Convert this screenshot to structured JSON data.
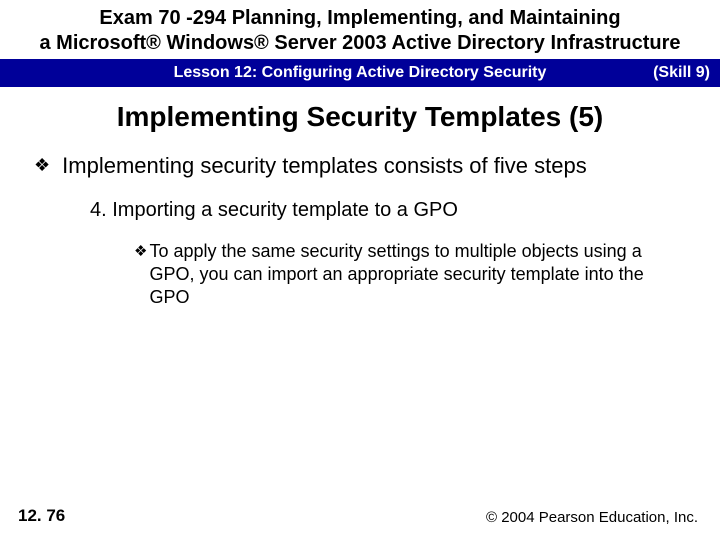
{
  "header": {
    "line1": "Exam 70 -294 Planning, Implementing, and Maintaining",
    "line2": "a Microsoft® Windows® Server 2003 Active Directory Infrastructure"
  },
  "bluebar": {
    "lesson": "Lesson 12: Configuring Active Directory Security",
    "skill": "(Skill 9)"
  },
  "title": "Implementing Security Templates (5)",
  "content": {
    "level1_bullet": "❖",
    "level1_text": "Implementing security templates consists of five steps",
    "level2_text": "4. Importing a security template to a GPO",
    "level3_bullet": "❖",
    "level3_text": "To apply the same security settings to multiple objects using a GPO, you can import an appropriate security template into the GPO"
  },
  "footer": {
    "page": "12. 76",
    "copyright": "© 2004 Pearson Education, Inc."
  }
}
